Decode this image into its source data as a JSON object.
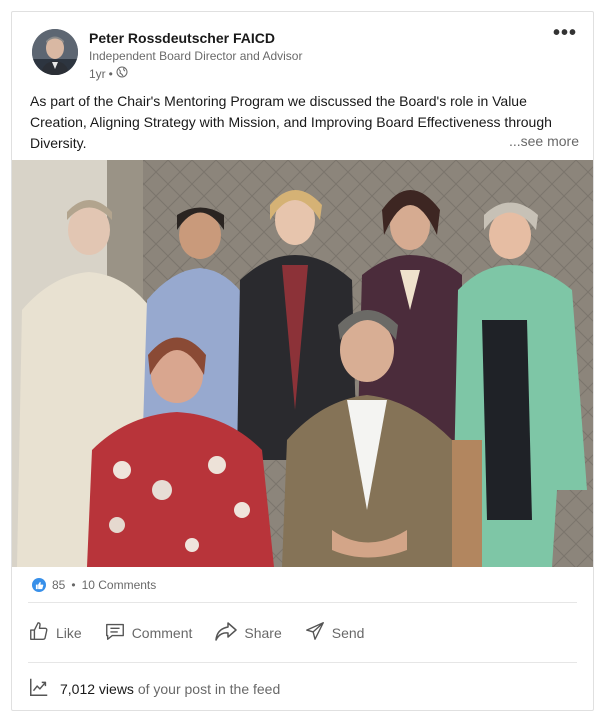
{
  "author": {
    "name": "Peter Rossdeutscher FAICD",
    "headline": "Independent Board Director and Advisor",
    "time": "1yr",
    "separator": "•"
  },
  "post": {
    "text": "As part of the Chair's Mentoring Program we discussed the Board's role in Value Creation, Aligning Strategy with Mission, and Improving Board Effectiveness through Diversity.",
    "see_more": "...see more"
  },
  "social": {
    "reactions": "85",
    "separator": "•",
    "comments": "10 Comments"
  },
  "actions": {
    "like": "Like",
    "comment": "Comment",
    "share": "Share",
    "send": "Send"
  },
  "views": {
    "count": "7,012 views",
    "suffix": "of your post in the feed"
  },
  "icons": {
    "more": "more-horizontal-icon",
    "visibility": "globe-icon",
    "reaction": "like-reaction-icon",
    "like": "thumbs-up-icon",
    "comment": "comment-icon",
    "share": "share-arrow-icon",
    "send": "send-icon",
    "views": "analytics-chart-icon"
  },
  "colors": {
    "reaction_blue": "#378fe9",
    "text_primary": "#000000e6",
    "text_secondary": "#00000099"
  }
}
